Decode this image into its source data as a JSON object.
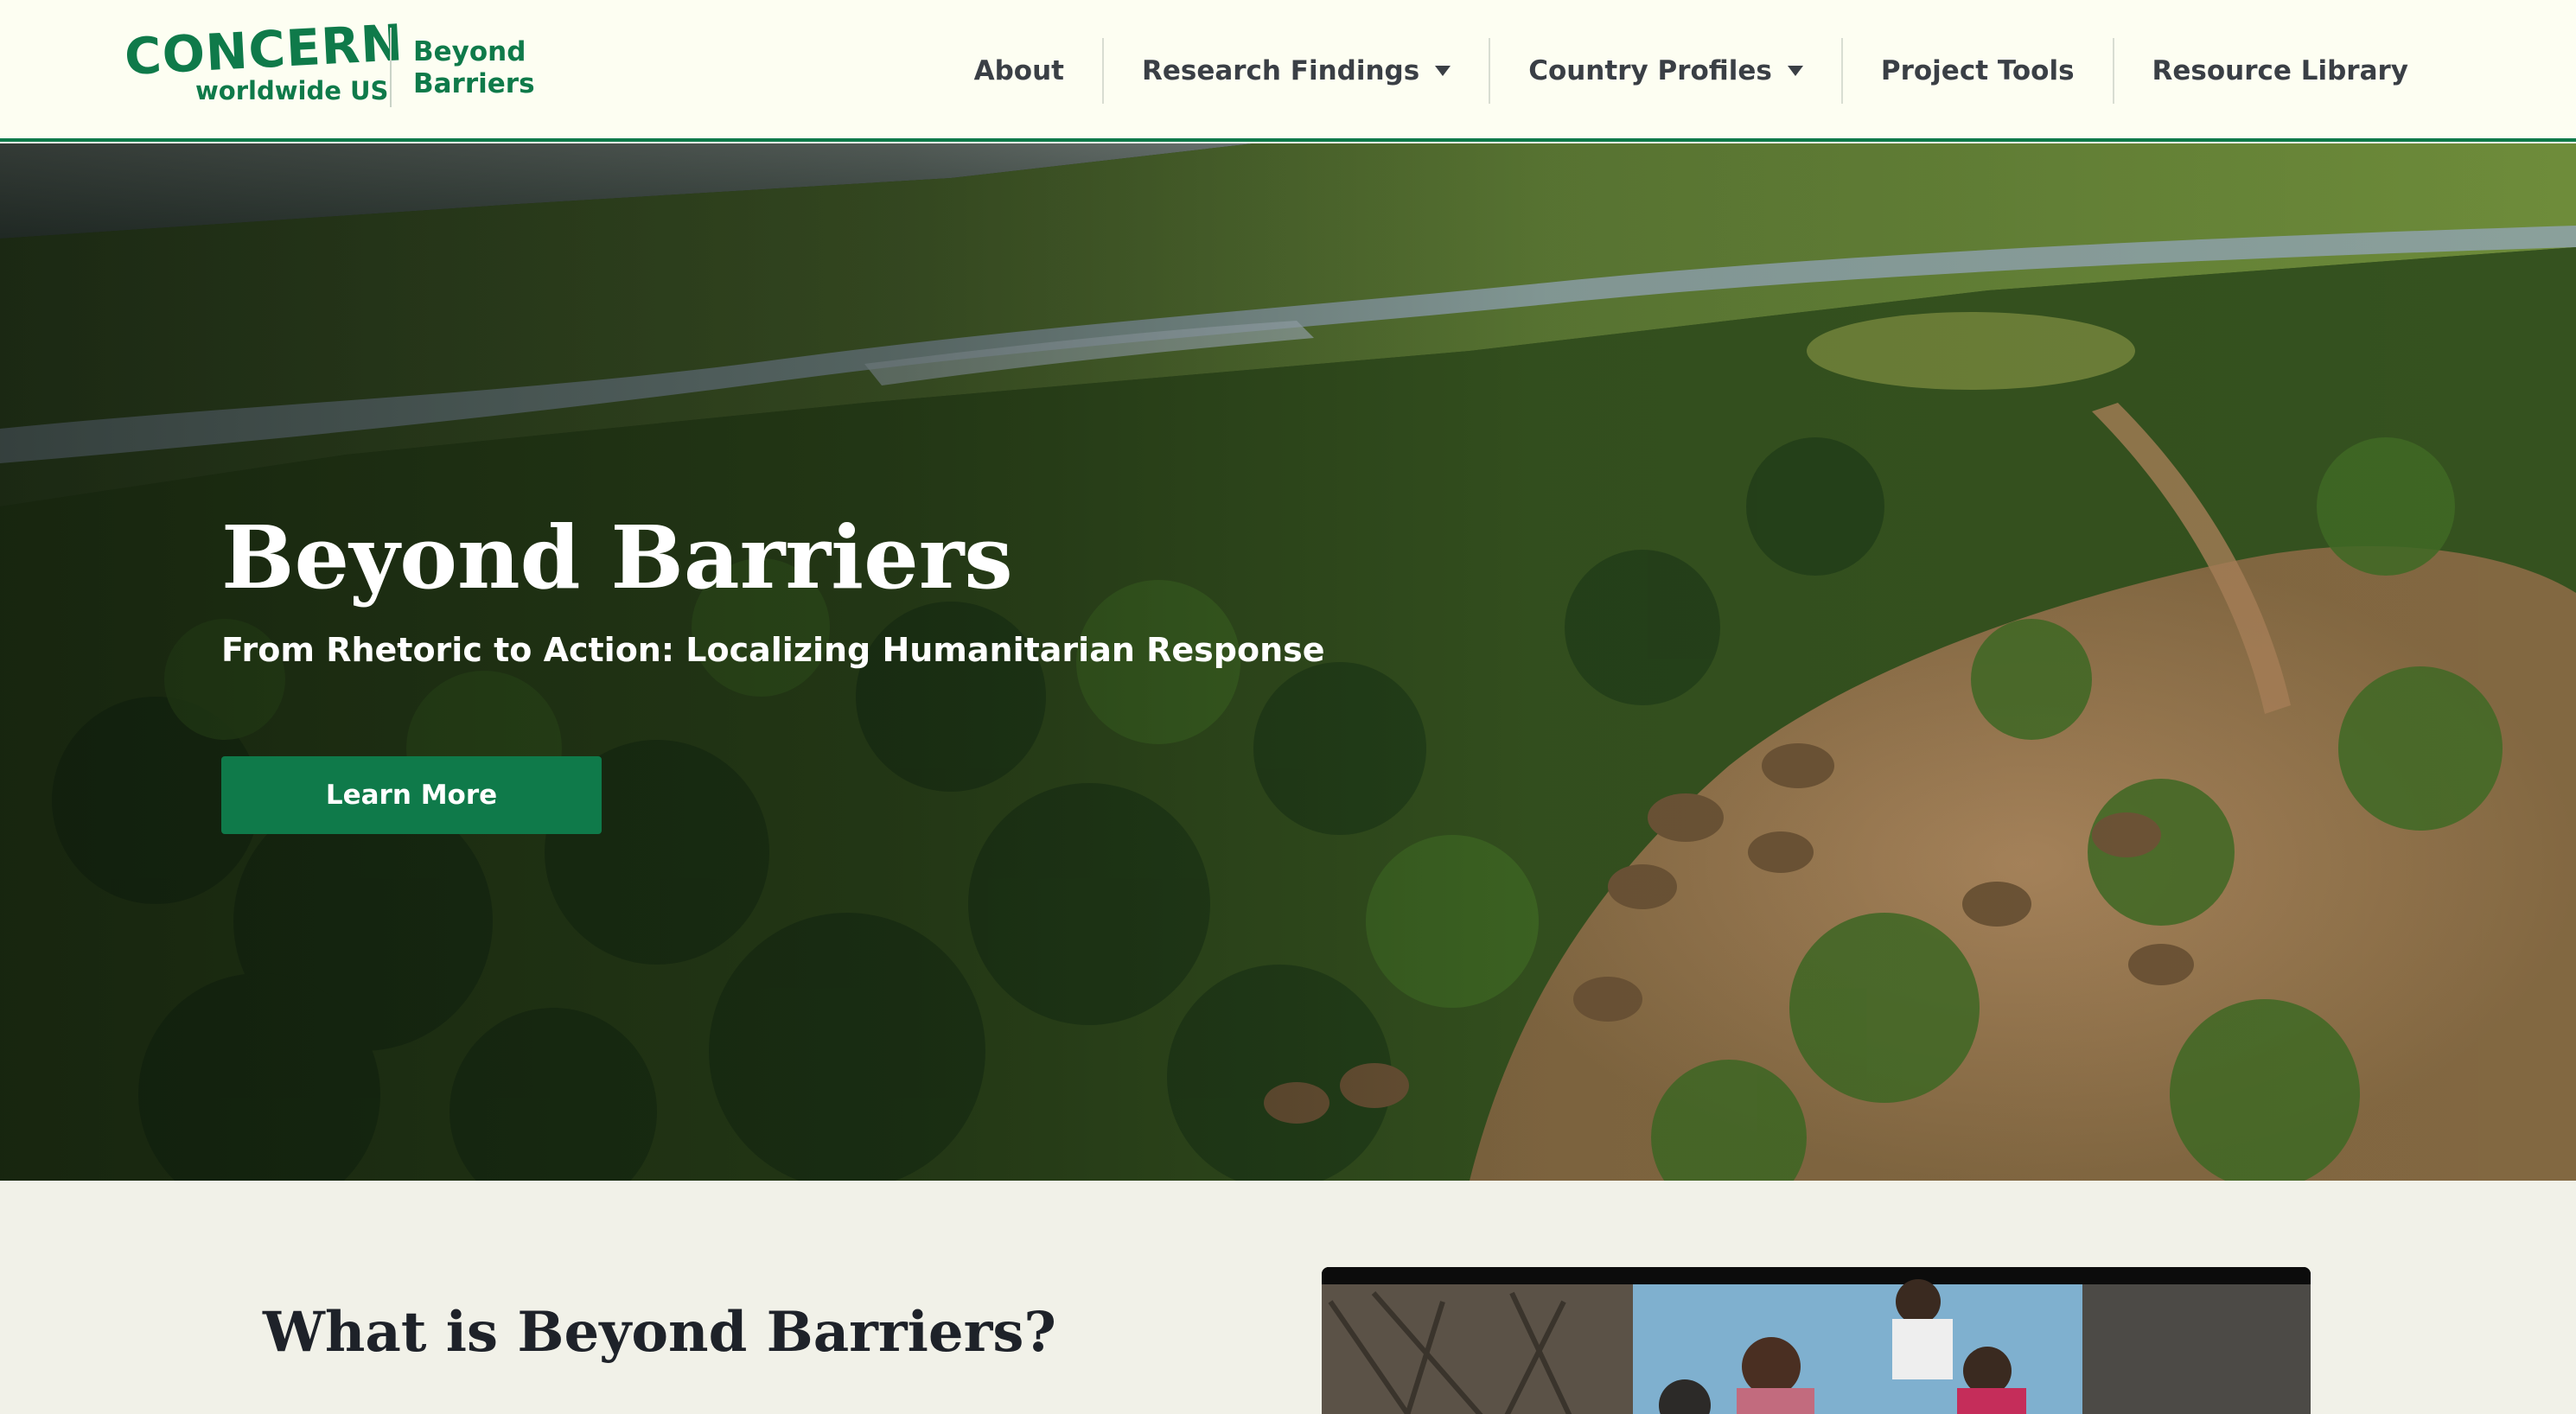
{
  "header": {
    "logo_primary": "CONCERN",
    "logo_secondary": "worldwide US",
    "brand_line1": "Beyond",
    "brand_line2": "Barriers"
  },
  "nav": {
    "items": [
      {
        "label": "About",
        "dropdown": false
      },
      {
        "label": "Research Findings",
        "dropdown": true
      },
      {
        "label": "Country Profiles",
        "dropdown": true
      },
      {
        "label": "Project Tools",
        "dropdown": false
      },
      {
        "label": "Resource Library",
        "dropdown": false
      }
    ]
  },
  "hero": {
    "title": "Beyond Barriers",
    "subtitle": "From Rhetoric to Action: Localizing Humanitarian Response",
    "cta_label": "Learn More"
  },
  "intro": {
    "heading": "What is Beyond Barriers?"
  },
  "colors": {
    "brand_green": "#0f7a4a",
    "header_bg": "#fdfef2",
    "section_bg": "#f1f1e8",
    "nav_text": "#3a3f45"
  },
  "icons": [
    "chevron-down-icon",
    "play-video-thumbnail"
  ]
}
